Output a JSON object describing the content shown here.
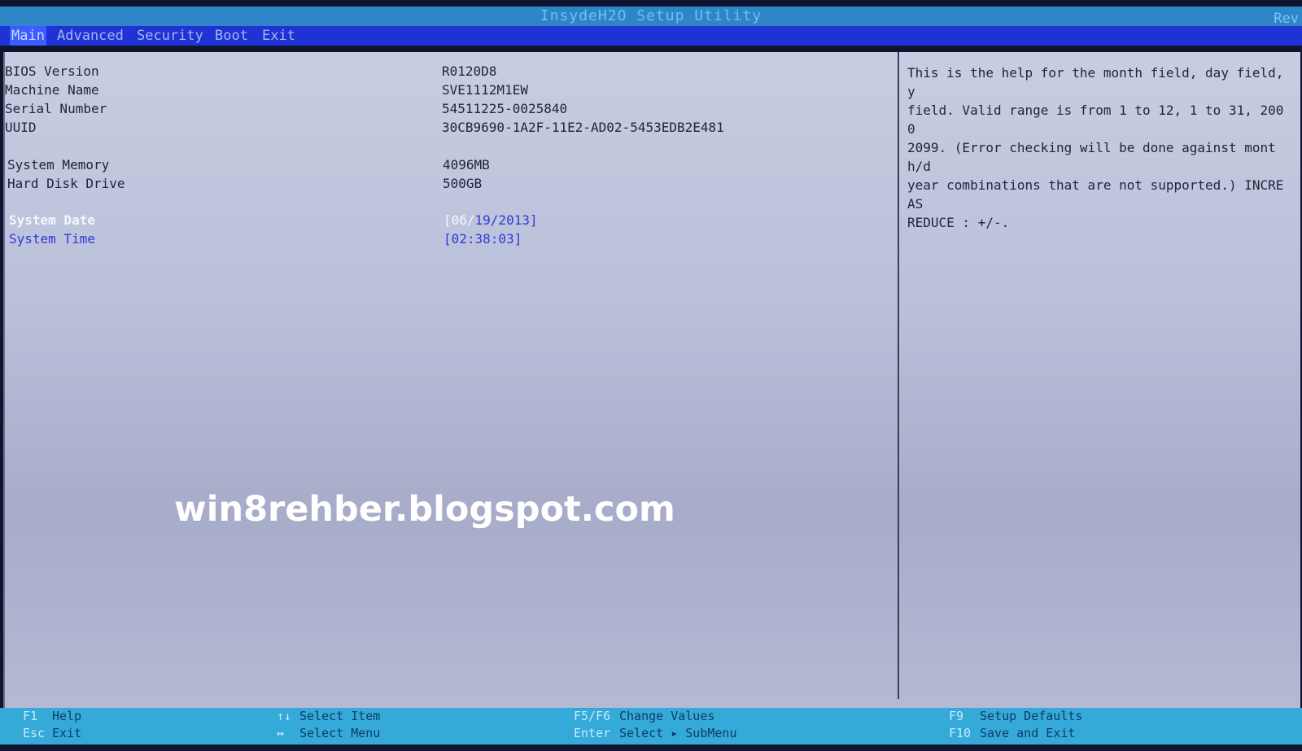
{
  "window": {
    "title": "InsydeH2O Setup Utility",
    "rev_label": "Rev"
  },
  "menu": {
    "items": [
      {
        "label": "Main",
        "active": true
      },
      {
        "label": "Advanced"
      },
      {
        "label": "Security"
      },
      {
        "label": "Boot"
      },
      {
        "label": "Exit"
      }
    ]
  },
  "info": {
    "rows": [
      {
        "label": "BIOS Version",
        "value": "R0120D8"
      },
      {
        "label": "Machine Name",
        "value": "SVE1112M1EW"
      },
      {
        "label": "Serial Number",
        "value": "54511225-0025840"
      },
      {
        "label": "UUID",
        "value": "30CB9690-1A2F-11E2-AD02-5453EDB2E481"
      },
      {
        "label": "System Memory",
        "value": "4096MB"
      },
      {
        "label": "Hard Disk Drive",
        "value": "500GB"
      }
    ],
    "system_date": {
      "label": "System Date",
      "value_open": "[06/",
      "value_rest": "19/2013]"
    },
    "system_time": {
      "label": "System Time",
      "value": "[02:38:03]"
    }
  },
  "help": {
    "text": "This is the help for the month field, day field, y\nfield. Valid range is from 1 to 12, 1 to 31, 2000\n2099. (Error checking will be done against month/d\nyear combinations that are not supported.) INCREAS\nREDUCE : +/-."
  },
  "watermark": "win8rehber.blogspot.com",
  "keys": {
    "col1": [
      {
        "key": "F1",
        "desc": "Help"
      },
      {
        "key": "Esc",
        "desc": "Exit"
      }
    ],
    "col2": [
      {
        "key": "↑↓",
        "desc": "Select Item"
      },
      {
        "key": "↔",
        "desc": "Select Menu"
      }
    ],
    "col3": [
      {
        "key": "F5/F6",
        "desc": "Change Values"
      },
      {
        "key": "Enter",
        "desc": "Select ▸ SubMenu"
      }
    ],
    "col4": [
      {
        "key": "F9",
        "desc": "Setup Defaults"
      },
      {
        "key": "F10",
        "desc": "Save and Exit"
      }
    ]
  }
}
